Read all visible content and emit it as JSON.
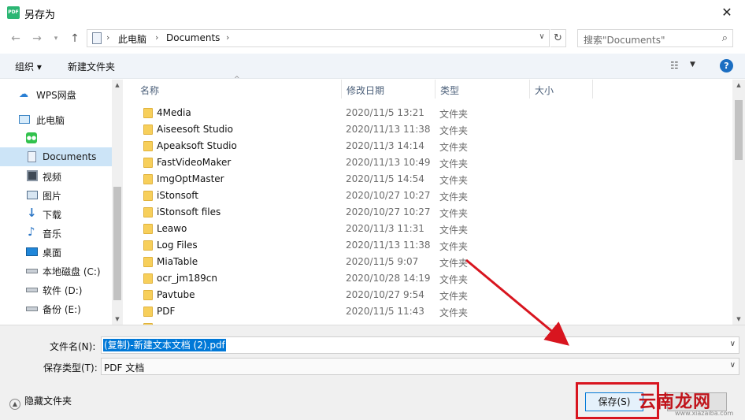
{
  "window": {
    "title": "另存为",
    "app_icon_text": "PDF",
    "close": "✕"
  },
  "address": {
    "path": [
      "此电脑",
      "Documents"
    ],
    "search_placeholder": "搜索\"Documents\""
  },
  "toolbar": {
    "organize": "组织 ▾",
    "new_folder": "新建文件夹",
    "help": "?"
  },
  "sidebar": {
    "items": [
      {
        "label": "WPS网盘",
        "icon": "cloud-icon"
      },
      {
        "label": "此电脑",
        "icon": "computer-icon"
      },
      {
        "label": "",
        "icon": "wechat-icon"
      },
      {
        "label": "Documents",
        "icon": "document-icon",
        "selected": true
      },
      {
        "label": "视频",
        "icon": "video-icon"
      },
      {
        "label": "图片",
        "icon": "picture-icon"
      },
      {
        "label": "下载",
        "icon": "download-icon"
      },
      {
        "label": "音乐",
        "icon": "music-icon"
      },
      {
        "label": "桌面",
        "icon": "desktop-icon"
      },
      {
        "label": "本地磁盘 (C:)",
        "icon": "drive-icon"
      },
      {
        "label": "软件 (D:)",
        "icon": "drive-icon"
      },
      {
        "label": "备份 (E:)",
        "icon": "drive-icon"
      }
    ]
  },
  "columns": {
    "name": "名称",
    "date": "修改日期",
    "type": "类型",
    "size": "大小"
  },
  "files": [
    {
      "name": "4Media",
      "date": "2020/11/5 13:21",
      "type": "文件夹"
    },
    {
      "name": "Aiseesoft Studio",
      "date": "2020/11/13 11:38",
      "type": "文件夹"
    },
    {
      "name": "Apeaksoft Studio",
      "date": "2020/11/3 14:14",
      "type": "文件夹"
    },
    {
      "name": "FastVideoMaker",
      "date": "2020/11/13 10:49",
      "type": "文件夹"
    },
    {
      "name": "ImgOptMaster",
      "date": "2020/11/5 14:54",
      "type": "文件夹"
    },
    {
      "name": "iStonsoft",
      "date": "2020/10/27 10:27",
      "type": "文件夹"
    },
    {
      "name": "iStonsoft files",
      "date": "2020/10/27 10:27",
      "type": "文件夹"
    },
    {
      "name": "Leawo",
      "date": "2020/11/3 11:31",
      "type": "文件夹"
    },
    {
      "name": "Log Files",
      "date": "2020/11/13 11:38",
      "type": "文件夹"
    },
    {
      "name": "MiaTable",
      "date": "2020/11/5 9:07",
      "type": "文件夹"
    },
    {
      "name": "ocr_jm189cn",
      "date": "2020/10/28 14:19",
      "type": "文件夹"
    },
    {
      "name": "Pavtube",
      "date": "2020/10/27 9:54",
      "type": "文件夹"
    },
    {
      "name": "PDF",
      "date": "2020/11/5 11:43",
      "type": "文件夹"
    }
  ],
  "bottom": {
    "filename_label": "文件名(N):",
    "filename_value": "(复制)-新建文本文档 (2).pdf",
    "filetype_label": "保存类型(T):",
    "filetype_value": "PDF 文档",
    "hide_folders": "隐藏文件夹",
    "save": "保存(S)"
  },
  "watermark": {
    "text": "云南龙网",
    "url": "www.xiazaiba.com"
  },
  "colors": {
    "highlight_red": "#d8151f",
    "selection_blue": "#0078d7",
    "folder_yellow": "#f7cf5b"
  }
}
